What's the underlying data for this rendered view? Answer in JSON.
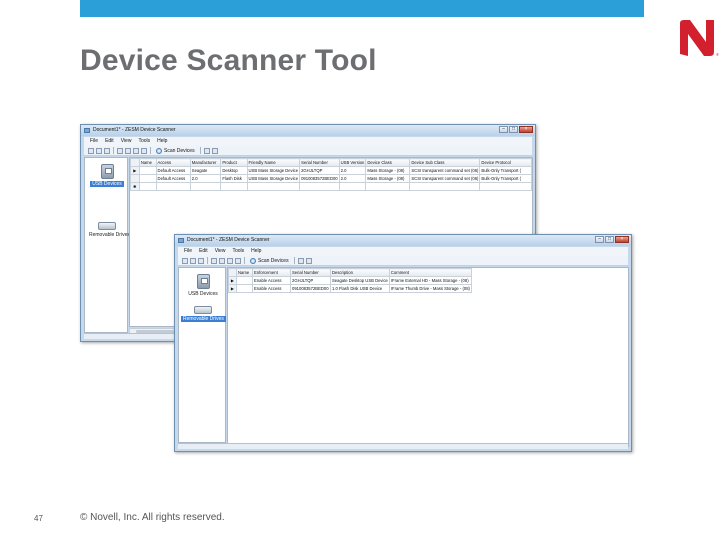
{
  "slide": {
    "title": "Device Scanner Tool",
    "page_number": "47",
    "copyright": "© Novell, Inc.  All rights reserved.",
    "accent_color": "#2a9fd8",
    "brand_color": "#d2202f"
  },
  "window1": {
    "title": "Document1* - ZESM Device Scanner",
    "menu": [
      "File",
      "Edit",
      "View",
      "Tools",
      "Help"
    ],
    "scan_label": "Scan Devices",
    "devices": [
      {
        "label": "USB Devices",
        "icon": "usb-drive-icon",
        "selected": true
      },
      {
        "label": "Removable Drives",
        "icon": "removable-drive-icon",
        "selected": false
      }
    ],
    "columns": [
      "Name",
      "Access",
      "Manufacturer",
      "Product",
      "Friendly Name",
      "Serial Number",
      "USB Version",
      "Device Class",
      "Device Sub Class",
      "Device Protocol"
    ],
    "rows": [
      [
        "",
        "Default Access",
        "Seagate",
        "Desktop",
        "USB Mass Storage Device",
        "2GHJLTQP",
        "2.0",
        "Mass Storage - (08)",
        "SCSI transparent command set (06)",
        "Bulk-Only Transport ("
      ],
      [
        "",
        "Default Access",
        "2.0",
        "Flash Disk",
        "USB Mass Storage Device",
        "0910083572BED00",
        "2.0",
        "Mass Storage - (08)",
        "SCSI transparent command set (06)",
        "Bulk-Only Transport ("
      ]
    ]
  },
  "window2": {
    "title": "Document1* - ZESM Device Scanner",
    "menu": [
      "File",
      "Edit",
      "View",
      "Tools",
      "Help"
    ],
    "scan_label": "Scan Devices",
    "devices": [
      {
        "label": "USB Devices",
        "icon": "usb-drive-icon",
        "selected": false
      },
      {
        "label": "Removable Drives",
        "icon": "removable-drive-icon",
        "selected": true
      }
    ],
    "columns": [
      "Name",
      "Enforcement",
      "Serial Number",
      "Description",
      "Comment"
    ],
    "rows": [
      [
        "",
        "Enable Access",
        "2GHJLTQP",
        "Seagate Desktop USB Device",
        "IFrame External HD - Mass Storage - (08)"
      ],
      [
        "",
        "Enable Access",
        "0910083572BED00",
        "1.0 Flash Disk USB Device",
        "IFrame Thumb Drive - Mass Storage - (08)"
      ]
    ]
  }
}
